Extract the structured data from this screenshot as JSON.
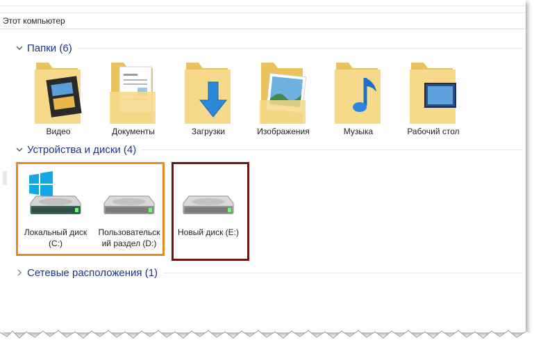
{
  "address": {
    "text": "Этот компьютер"
  },
  "sections": {
    "folders": {
      "title": "Папки (6)"
    },
    "devices": {
      "title": "Устройства и диски (4)"
    },
    "network": {
      "title": "Сетевые расположения (1)"
    }
  },
  "folders": [
    {
      "label": "Видео",
      "icon": "video-folder-icon"
    },
    {
      "label": "Документы",
      "icon": "documents-folder-icon"
    },
    {
      "label": "Загрузки",
      "icon": "downloads-folder-icon"
    },
    {
      "label": "Изображения",
      "icon": "pictures-folder-icon"
    },
    {
      "label": "Музыка",
      "icon": "music-folder-icon"
    },
    {
      "label": "Рабочий стол",
      "icon": "desktop-folder-icon"
    }
  ],
  "drives": [
    {
      "line1": "Локальный диск",
      "line2": "(C:)",
      "icon": "system-drive-icon"
    },
    {
      "line1": "Пользовательск",
      "line2": "ий раздел (D:)",
      "icon": "hard-drive-icon"
    },
    {
      "line1": "Новый диск (E:)",
      "line2": "",
      "icon": "hard-drive-icon"
    }
  ],
  "colors": {
    "section_title": "#1e3287",
    "highlight_orange": "#e48a20",
    "highlight_red": "#6e1414",
    "folder_yellow": "#f4d27a"
  }
}
